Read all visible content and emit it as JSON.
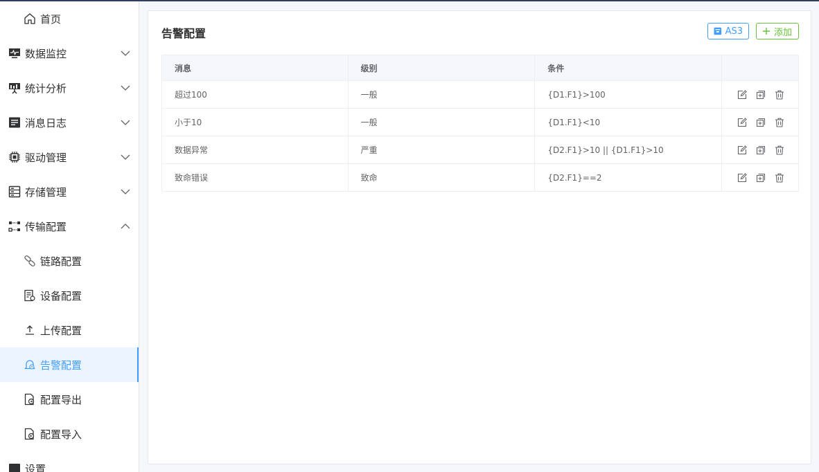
{
  "sidebar": {
    "items": [
      {
        "label": "首页",
        "icon": "home-icon"
      },
      {
        "label": "数据监控",
        "icon": "monitor-icon"
      },
      {
        "label": "统计分析",
        "icon": "chart-icon"
      },
      {
        "label": "消息日志",
        "icon": "log-icon"
      },
      {
        "label": "驱动管理",
        "icon": "chip-icon"
      },
      {
        "label": "存储管理",
        "icon": "storage-icon"
      },
      {
        "label": "传输配置",
        "icon": "transfer-icon"
      },
      {
        "label": "链路配置",
        "icon": "link-icon"
      },
      {
        "label": "设备配置",
        "icon": "device-icon"
      },
      {
        "label": "上传配置",
        "icon": "upload-icon"
      },
      {
        "label": "告警配置",
        "icon": "alarm-icon"
      },
      {
        "label": "配置导出",
        "icon": "export-icon"
      },
      {
        "label": "配置导入",
        "icon": "import-icon"
      },
      {
        "label": "设置",
        "icon": "settings-icon"
      }
    ]
  },
  "main": {
    "title": "告警配置",
    "as3_label": "AS3",
    "add_label": "添加",
    "table": {
      "headers": [
        "消息",
        "级别",
        "条件",
        ""
      ],
      "rows": [
        {
          "message": "超过100",
          "level": "一般",
          "condition": "{D1.F1}>100"
        },
        {
          "message": "小于10",
          "level": "一般",
          "condition": "{D1.F1}<10"
        },
        {
          "message": "数据异常",
          "level": "严重",
          "condition": "{D2.F1}>10 || {D1.F1}>10"
        },
        {
          "message": "致命错误",
          "level": "致命",
          "condition": "{D2.F1}==2"
        }
      ]
    }
  },
  "colors": {
    "accent": "#409eff",
    "success": "#67c23a",
    "active_bg": "#ecf5ff"
  }
}
